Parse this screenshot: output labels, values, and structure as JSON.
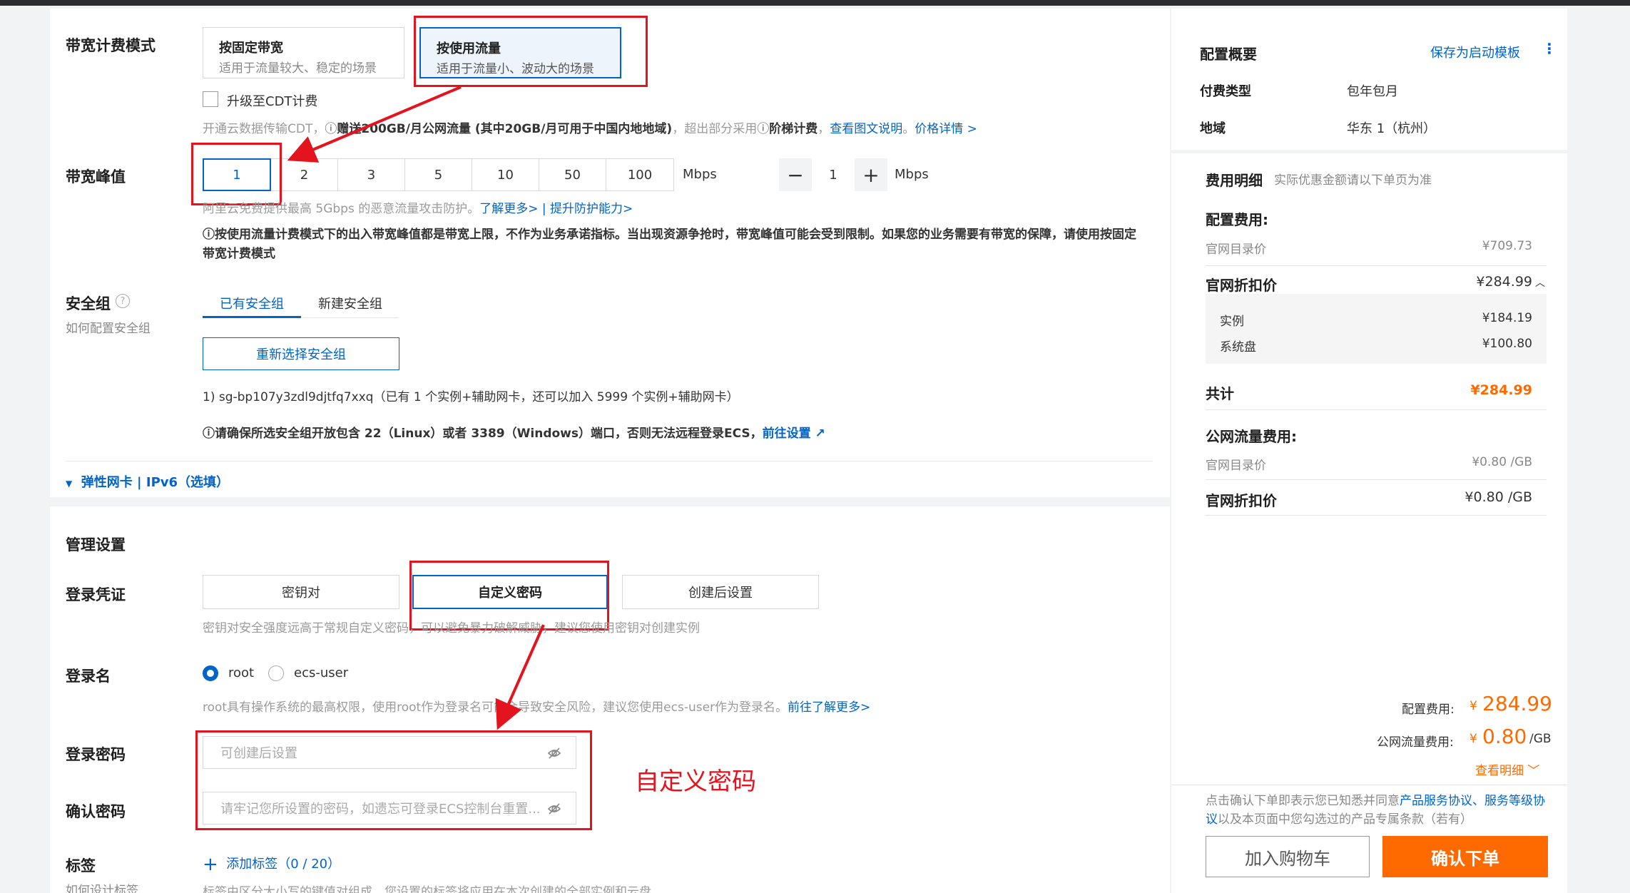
{
  "bandwidth_billing": {
    "label": "带宽计费模式",
    "options": [
      {
        "title": "按固定带宽",
        "desc": "适用于流量较大、稳定的场景"
      },
      {
        "title": "按使用流量",
        "desc": "适用于流量小、波动大的场景"
      }
    ],
    "cdt_checkbox": "升级至CDT计费",
    "cdt_hint_pre": "开通云数据传输CDT，",
    "cdt_hint_bold": "赠送200GB/月公网流量 (其中20GB/月可用于中国内地地域)",
    "cdt_hint_mid": "，超出部分采用",
    "cdt_hint_bold2": "阶梯计费",
    "cdt_link1": "查看图文说明",
    "cdt_link2": "价格详情 >"
  },
  "bandwidth_peak": {
    "label": "带宽峰值",
    "values": [
      "1",
      "2",
      "3",
      "5",
      "10",
      "50",
      "100"
    ],
    "unit": "Mbps",
    "stepper_value": "1",
    "stepper_unit": "Mbps",
    "hint_pre": "阿里云免费提供最高 5Gbps 的恶意流量攻击防护。",
    "hint_link1": "了解更多>",
    "hint_sep": " | ",
    "hint_link2": "提升防护能力>",
    "warning": "按使用流量计费模式下的出入带宽峰值都是带宽上限，不作为业务承诺指标。当出现资源争抢时，带宽峰值可能会受到限制。如果您的业务需要有带宽的保障，请使用按固定带宽计费模式"
  },
  "security_group": {
    "label": "安全组",
    "sublabel": "如何配置安全组",
    "tabs": [
      "已有安全组",
      "新建安全组"
    ],
    "reselect_button": "重新选择安全组",
    "selected": "1) sg-bp107y3zdl9djtfq7xxq（已有 1 个实例+辅助网卡，还可以加入 5999 个实例+辅助网卡）",
    "warning": "请确保所选安全组开放包含 22（Linux）或者 3389（Windows）端口，否则无法远程登录ECS，",
    "warning_link": "前往设置"
  },
  "eni_toggle": "弹性网卡 | IPv6（选填）",
  "management": {
    "title": "管理设置",
    "login_credential_label": "登录凭证",
    "credential_options": [
      "密钥对",
      "自定义密码",
      "创建后设置"
    ],
    "credential_hint": "密钥对安全强度远高于常规自定义密码，可以避免暴力破解威胁，建议您使用密钥对创建实例",
    "login_name_label": "登录名",
    "login_names": [
      "root",
      "ecs-user"
    ],
    "login_name_hint": "root具有操作系统的最高权限，使用root作为登录名可能会导致安全风险，建议您使用ecs-user作为登录名。",
    "login_name_link": "前往了解更多>",
    "password_label": "登录密码",
    "password_placeholder": "可创建后设置",
    "confirm_label": "确认密码",
    "confirm_placeholder": "请牢记您所设置的密码，如遗忘可登录ECS控制台重置...",
    "tag_label": "标签",
    "tag_sublabel": "如何设计标签",
    "tag_add": "添加标签",
    "tag_count": "（0 / 20）",
    "tag_hint": "标签由区分大小写的键值对组成，您设置的标签将应用在本次创建的全部实例和云盘"
  },
  "annotation": "自定义密码",
  "summary": {
    "title": "配置概要",
    "save_template": "保存为启动模板",
    "pay_type_label": "付费类型",
    "pay_type_value": "包年包月",
    "region_label": "地域",
    "region_value": "华东 1（杭州）",
    "fee_title": "费用明细",
    "fee_note": "实际优惠金额请以下单页为准",
    "config_fee_title": "配置费用:",
    "list_price_label": "官网目录价",
    "list_price_value": "¥709.73",
    "discount_label": "官网折扣价",
    "discount_value": "¥284.99",
    "instance_label": "实例",
    "instance_value": "¥184.19",
    "disk_label": "系统盘",
    "disk_value": "¥100.80",
    "total_label": "共计",
    "total_value": "¥284.99",
    "traffic_title": "公网流量费用:",
    "traffic_list_label": "官网目录价",
    "traffic_list_value": "¥0.80 /GB",
    "traffic_discount_label": "官网折扣价",
    "traffic_discount_value": "¥0.80 /GB",
    "bottom_config_label": "配置费用:",
    "bottom_config_currency": "¥",
    "bottom_config_value": "284.99",
    "bottom_traffic_label": "公网流量费用:",
    "bottom_traffic_currency": "¥",
    "bottom_traffic_value": "0.80",
    "bottom_traffic_unit": "/GB",
    "view_detail": "查看明细",
    "agree_pre": "点击确认下单即表示您已知悉并同意",
    "agree_link1": "产品服务协议",
    "agree_sep": "、",
    "agree_link2": "服务等级协议",
    "agree_post": "以及本页面中您勾选过的产品专属条款（若有）",
    "cart_button": "加入购物车",
    "order_button": "确认下单"
  },
  "colors": {
    "accent": "#0064c8",
    "orange": "#ff6a00",
    "annotation_red": "#e4141e"
  }
}
